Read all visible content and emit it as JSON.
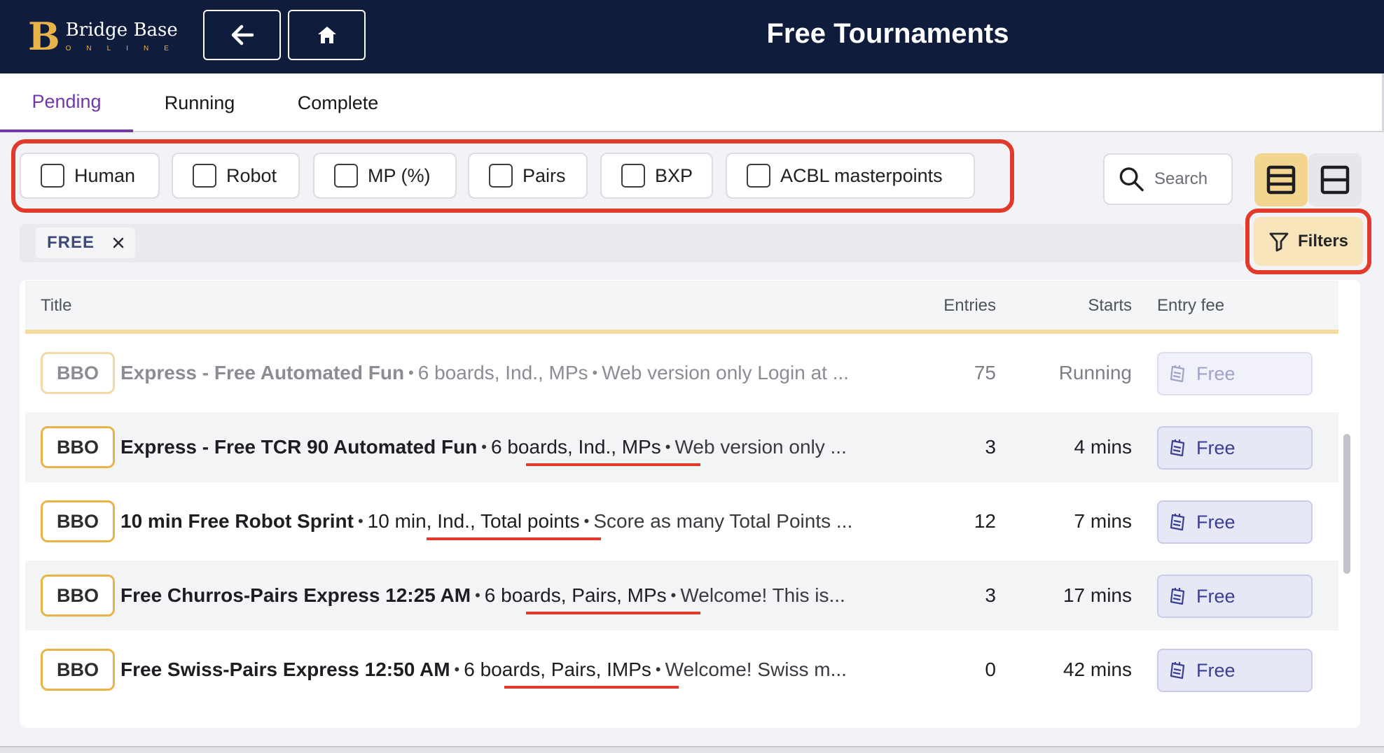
{
  "header": {
    "logo_name": "Bridge Base",
    "logo_sub": "ONLINE",
    "title": "Free Tournaments",
    "back_icon": "arrow-left-icon",
    "home_icon": "home-icon"
  },
  "tabs": [
    {
      "label": "Pending",
      "active": true
    },
    {
      "label": "Running",
      "active": false
    },
    {
      "label": "Complete",
      "active": false
    }
  ],
  "filters": {
    "chips": [
      {
        "label": "Human",
        "checked": false
      },
      {
        "label": "Robot",
        "checked": false
      },
      {
        "label": "MP (%)",
        "checked": false
      },
      {
        "label": "Pairs",
        "checked": false
      },
      {
        "label": "BXP",
        "checked": false
      },
      {
        "label": "ACBL masterpoints",
        "checked": false
      }
    ],
    "search_placeholder": "Search",
    "active_tag": "FREE",
    "filters_button": "Filters"
  },
  "table": {
    "columns": {
      "title": "Title",
      "entries": "Entries",
      "starts": "Starts",
      "fee": "Entry fee"
    },
    "rows": [
      {
        "badge": "BBO",
        "title": "Express - Free Automated Fun",
        "meta": "6 boards, Ind., MPs",
        "desc": "Web version only Login at ...",
        "entries": "75",
        "starts": "Running",
        "fee": "Free",
        "dimmed": true
      },
      {
        "badge": "BBO",
        "title": "Express - Free TCR 90 Automated Fun",
        "meta": "6 boards, Ind., MPs",
        "desc": "Web version only ...",
        "entries": "3",
        "starts": "4 mins",
        "fee": "Free",
        "dimmed": false
      },
      {
        "badge": "BBO",
        "title": "10 min Free Robot Sprint",
        "meta": "10 min, Ind., Total points",
        "desc": "Score as many Total Points ...",
        "entries": "12",
        "starts": "7 mins",
        "fee": "Free",
        "dimmed": false
      },
      {
        "badge": "BBO",
        "title": "Free Churros-Pairs Express 12:25 AM",
        "meta": "6 boards, Pairs, MPs",
        "desc": "Welcome! This is...",
        "entries": "3",
        "starts": "17 mins",
        "fee": "Free",
        "dimmed": false
      },
      {
        "badge": "BBO",
        "title": "Free Swiss-Pairs Express 12:50 AM",
        "meta": "6 boards, Pairs, IMPs",
        "desc": "Welcome! Swiss m...",
        "entries": "0",
        "starts": "42 mins",
        "fee": "Free",
        "dimmed": false
      }
    ]
  },
  "colors": {
    "header_bg": "#0f1c3b",
    "accent_gold": "#e8b44a",
    "tab_active": "#6f3aa8",
    "highlight_red": "#e23a2a",
    "fee_blue": "#3a3f94"
  }
}
